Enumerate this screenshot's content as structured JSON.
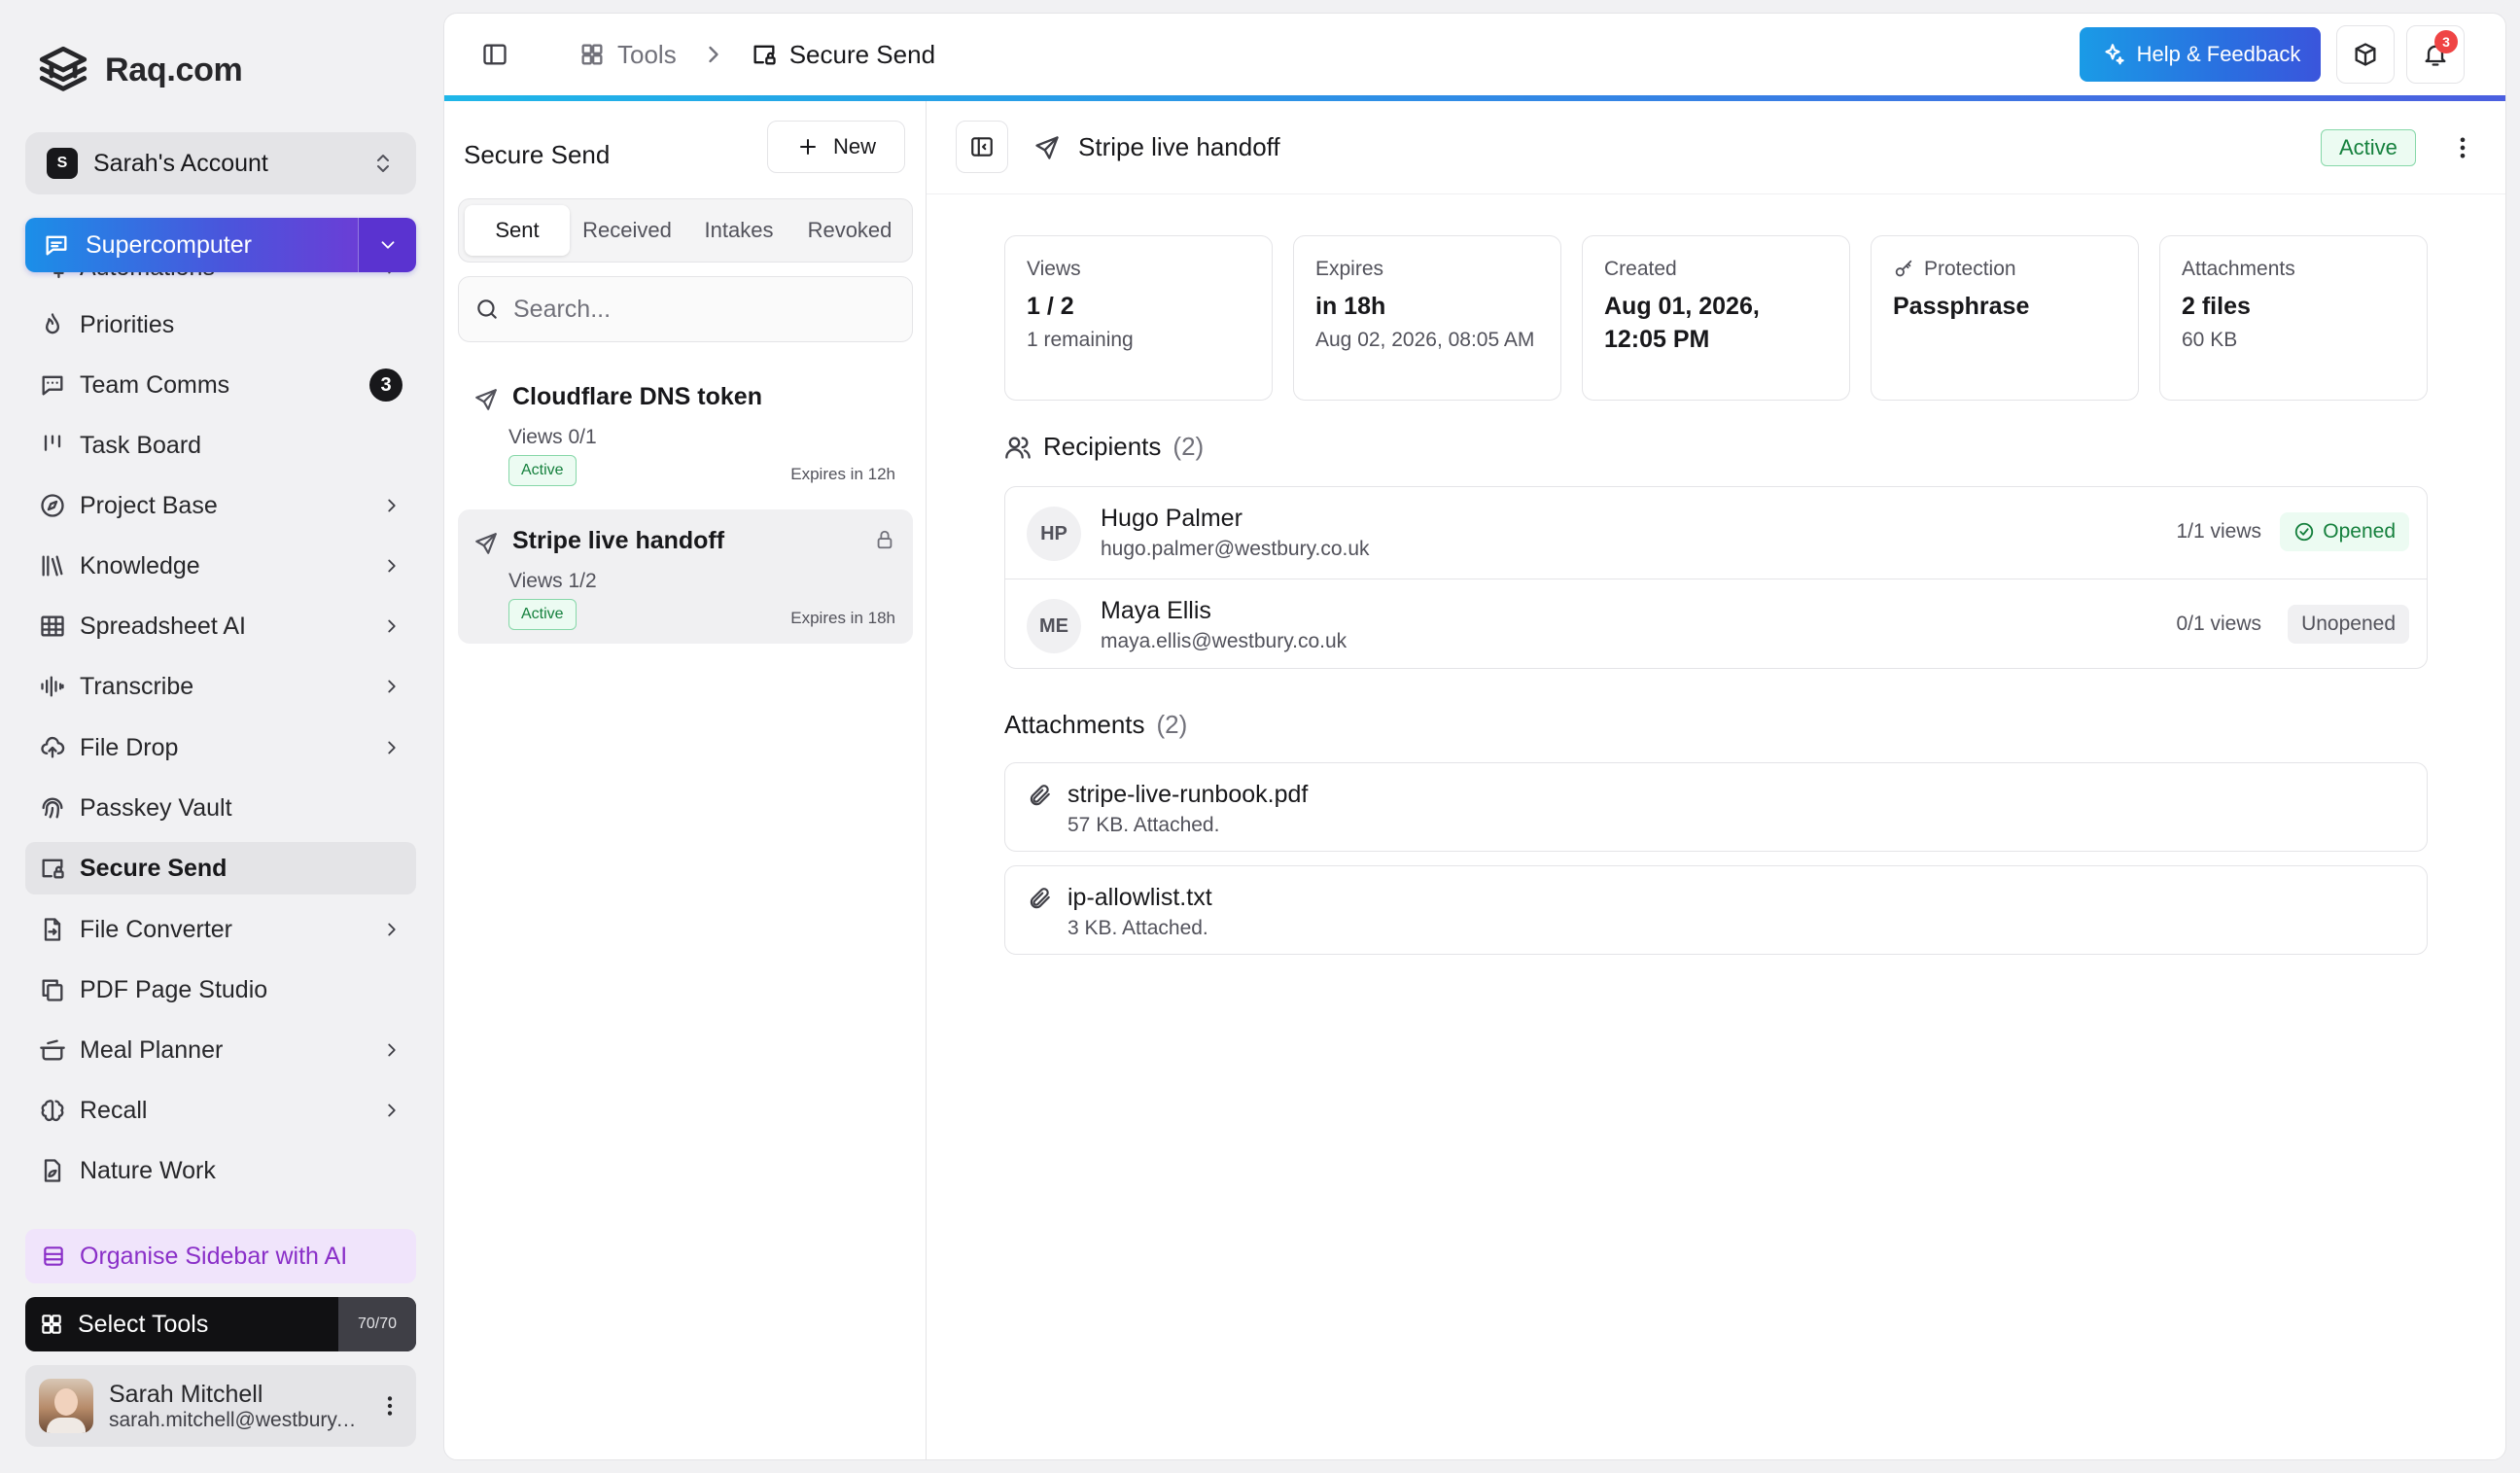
{
  "brand": {
    "name": "Raq.com"
  },
  "account": {
    "initial": "S",
    "name": "Sarah's Account"
  },
  "supercomputer": {
    "label": "Supercomputer"
  },
  "sidebar": {
    "items": [
      {
        "label": "Automations",
        "icon": "automations-icon",
        "chevron": true
      },
      {
        "label": "Priorities",
        "icon": "flame-icon"
      },
      {
        "label": "Team Comms",
        "icon": "message-icon",
        "badge": "3"
      },
      {
        "label": "Task Board",
        "icon": "kanban-icon"
      },
      {
        "label": "Project Base",
        "icon": "compass-icon",
        "chevron": true
      },
      {
        "label": "Knowledge",
        "icon": "library-icon",
        "chevron": true
      },
      {
        "label": "Spreadsheet AI",
        "icon": "grid-icon",
        "chevron": true
      },
      {
        "label": "Transcribe",
        "icon": "waveform-icon",
        "chevron": true
      },
      {
        "label": "File Drop",
        "icon": "cloud-upload-icon",
        "chevron": true
      },
      {
        "label": "Passkey Vault",
        "icon": "fingerprint-icon"
      },
      {
        "label": "Secure Send",
        "icon": "secure-send-icon",
        "active": true
      },
      {
        "label": "File Converter",
        "icon": "file-convert-icon",
        "chevron": true
      },
      {
        "label": "PDF Page Studio",
        "icon": "copy-icon"
      },
      {
        "label": "Meal Planner",
        "icon": "pot-icon",
        "chevron": true
      },
      {
        "label": "Recall",
        "icon": "brain-icon",
        "chevron": true
      },
      {
        "label": "Nature Work",
        "icon": "leaf-picture-icon"
      }
    ]
  },
  "organise": {
    "label": "Organise Sidebar with AI"
  },
  "select_tools": {
    "label": "Select Tools",
    "count": "70/70"
  },
  "user": {
    "name": "Sarah Mitchell",
    "email": "sarah.mitchell@westbury.co.uk"
  },
  "header": {
    "crumb_tools": "Tools",
    "crumb_current": "Secure Send",
    "help_label": "Help & Feedback",
    "notification_count": "3"
  },
  "list": {
    "title": "Secure Send",
    "new_label": "New",
    "tabs": [
      "Sent",
      "Received",
      "Intakes",
      "Revoked"
    ],
    "active_tab": "Sent",
    "search_placeholder": "Search...",
    "items": [
      {
        "title": "Cloudflare DNS token",
        "views": "Views 0/1",
        "status": "Active",
        "expires": "Expires in 12h",
        "locked": false
      },
      {
        "title": "Stripe live handoff",
        "views": "Views 1/2",
        "status": "Active",
        "expires": "Expires in 18h",
        "locked": true
      }
    ]
  },
  "detail": {
    "title": "Stripe live handoff",
    "status": "Active",
    "stats": [
      {
        "label": "Views",
        "value": "1 / 2",
        "sub": "1 remaining"
      },
      {
        "label": "Expires",
        "value": "in 18h",
        "sub": "Aug 02, 2026, 08:05 AM"
      },
      {
        "label": "Created",
        "value": "Aug 01, 2026, 12:05 PM",
        "sub": ""
      },
      {
        "label": "Protection",
        "value": "Passphrase",
        "sub": ""
      },
      {
        "label": "Attachments",
        "value": "2 files",
        "sub": "60 KB"
      }
    ],
    "recipients_title": "Recipients",
    "recipients_count": "(2)",
    "recipients": [
      {
        "initials": "HP",
        "name": "Hugo Palmer",
        "email": "hugo.palmer@westbury.co.uk",
        "views": "1/1 views",
        "status": "Opened"
      },
      {
        "initials": "ME",
        "name": "Maya Ellis",
        "email": "maya.ellis@westbury.co.uk",
        "views": "0/1 views",
        "status": "Unopened"
      }
    ],
    "attachments_title": "Attachments",
    "attachments_count": "(2)",
    "attachments": [
      {
        "name": "stripe-live-runbook.pdf",
        "meta": "57 KB. Attached."
      },
      {
        "name": "ip-allowlist.txt",
        "meta": "3 KB. Attached."
      }
    ]
  },
  "colors": {
    "accent_blue": "#1b8fe8",
    "accent_purple": "#6a3ed6",
    "success_green": "#15803d",
    "notification_red": "#ef4444"
  }
}
